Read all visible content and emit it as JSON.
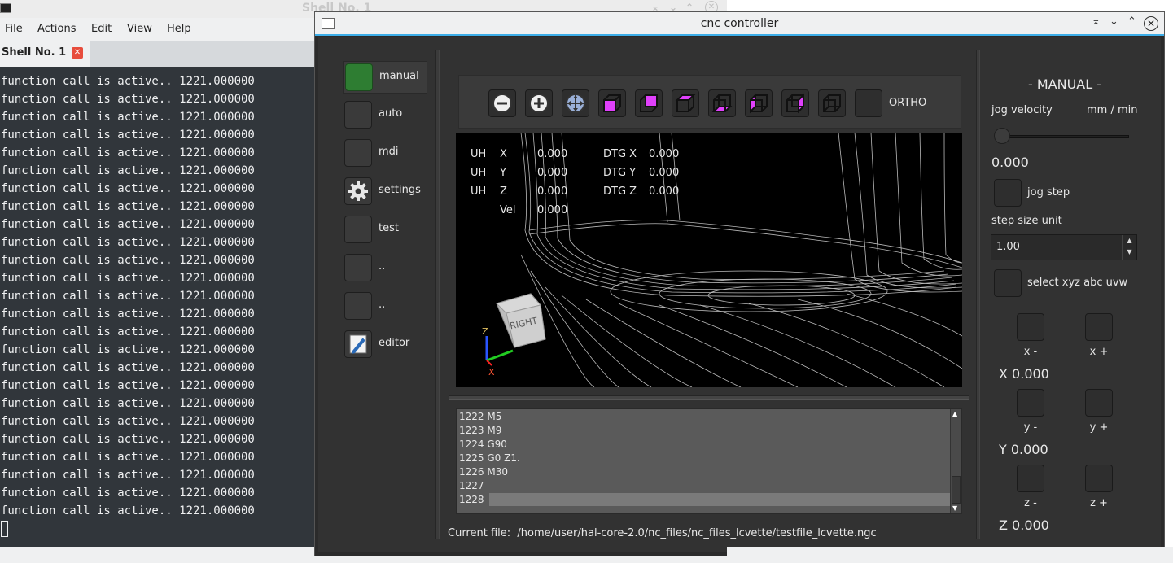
{
  "terminal": {
    "title": "Shell No. 1",
    "menu": [
      "File",
      "Actions",
      "Edit",
      "View",
      "Help"
    ],
    "tab_label": "Shell No. 1",
    "line_text": "function call is active.. 1221.000000",
    "line_count": 25
  },
  "cnc": {
    "title": "cnc controller",
    "nav": [
      {
        "label": "manual",
        "icon": "green-square-icon"
      },
      {
        "label": "auto",
        "icon": "blank-button-icon"
      },
      {
        "label": "mdi",
        "icon": "blank-button-icon"
      },
      {
        "label": "settings",
        "icon": "gear-icon"
      },
      {
        "label": "test",
        "icon": "blank-button-icon"
      },
      {
        "label": "..",
        "icon": "blank-button-icon"
      },
      {
        "label": "..",
        "icon": "blank-button-icon"
      },
      {
        "label": "editor",
        "icon": "edit-icon"
      }
    ],
    "toolbar": {
      "ortho_label": "ORTHO",
      "icons": [
        "zoom-out-icon",
        "zoom-in-icon",
        "fit-view-icon",
        "view-front-icon",
        "view-iso-icon",
        "view-top-icon",
        "view-bottom-icon",
        "view-left-icon",
        "view-right-icon",
        "view-back-icon"
      ]
    },
    "dro": {
      "rows": [
        {
          "unit": "UH",
          "axis": "X",
          "value": "0.000",
          "dtg_label": "DTG X",
          "dtg": "0.000"
        },
        {
          "unit": "UH",
          "axis": "Y",
          "value": "0.000",
          "dtg_label": "DTG Y",
          "dtg": "0.000"
        },
        {
          "unit": "UH",
          "axis": "Z",
          "value": "0.000",
          "dtg_label": "DTG Z",
          "dtg": "0.000"
        }
      ],
      "vel_label": "Vel",
      "vel": "0.000"
    },
    "viewcube": {
      "face": "RIGHT",
      "axes": [
        "Z",
        "X"
      ]
    },
    "gcode_lines": [
      "1222 M5",
      "1223 M9",
      "1224 G90",
      "1225 G0 Z1.",
      "1226 M30",
      "1227",
      "1228"
    ],
    "current_file_label": "Current file:",
    "current_file": "/home/user/hal-core-2.0/nc_files/nc_files_lcvette/testfile_lcvette.ngc",
    "panel": {
      "mode_title": "- MANUAL -",
      "jog_velocity_label": "jog velocity",
      "jog_velocity_unit": "mm / min",
      "jog_velocity_value": "0.000",
      "jog_velocity_fraction": 0.0,
      "jog_step_label": "jog step",
      "step_size_unit_label": "step size unit",
      "step_size_value": "1.00",
      "select_label": "select xyz abc uvw",
      "x_minus": "x -",
      "x_plus": "x +",
      "x_pos": "X 0.000",
      "y_minus": "y -",
      "y_plus": "y +",
      "y_pos": "Y 0.000",
      "z_minus": "z -",
      "z_plus": "z +",
      "z_pos": "Z 0.000"
    }
  }
}
